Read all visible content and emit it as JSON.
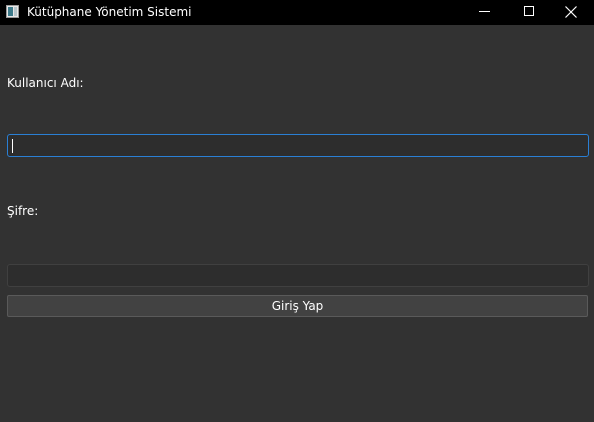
{
  "window": {
    "title": "Kütüphane Yönetim Sistemi",
    "icon": "library-app-icon",
    "controls": {
      "minimize_icon": "minimize-icon",
      "maximize_icon": "maximize-icon",
      "close_icon": "close-icon"
    }
  },
  "form": {
    "username_label": "Kullanıcı Adı:",
    "username_value": "",
    "username_focused": true,
    "password_label": "Şifre:",
    "password_value": "",
    "login_button_label": "Giriş Yap"
  },
  "colors": {
    "titlebar": "#000000",
    "window_background": "#323232",
    "input_background": "#2d2d2d",
    "focus_accent": "#2a7fd4",
    "button_background": "#424242",
    "text": "#ffffff"
  }
}
